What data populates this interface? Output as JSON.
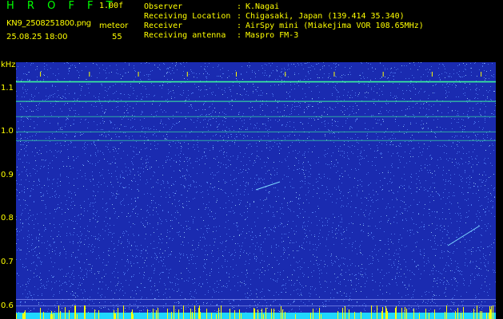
{
  "header": {
    "brand": "H R O F F T",
    "version": "1.00f",
    "filename": "KN9_2508251800.png",
    "meteor_label": "meteor",
    "date": "25.08.25 18:00",
    "meteor_count": "55",
    "meta": [
      {
        "key": "Observer",
        "value": "K.Nagai"
      },
      {
        "key": "Receiving Location",
        "value": "Chigasaki, Japan (139.414 35.340)"
      },
      {
        "key": "Receiver",
        "value": "AirSpy mini (Miakejima VOR 108.65MHz)"
      },
      {
        "key": "Receiving antenna",
        "value": "Maspro FM-3"
      }
    ]
  },
  "chart_data": {
    "type": "heatmap",
    "y_unit": "kHz",
    "y_ticks": [
      "1.1",
      "1.0",
      "0.9",
      "0.8",
      "0.7",
      "0.6"
    ],
    "x_ticks": [
      "1801",
      "1802",
      "1803",
      "1804",
      "1805",
      "1806",
      "1807",
      "1808",
      "1809",
      "1810"
    ],
    "ylim": [
      0.57,
      1.16
    ],
    "xlim": [
      1800.5,
      1810.3
    ],
    "horizontal_lines_khz": [
      1.115,
      1.07,
      1.035,
      1.0,
      0.98,
      0.615,
      0.6
    ],
    "colors": {
      "background": "#1a2bb0",
      "noise": "#5a8cff",
      "line": "#3cff9a",
      "tick": "#ffff00"
    }
  }
}
